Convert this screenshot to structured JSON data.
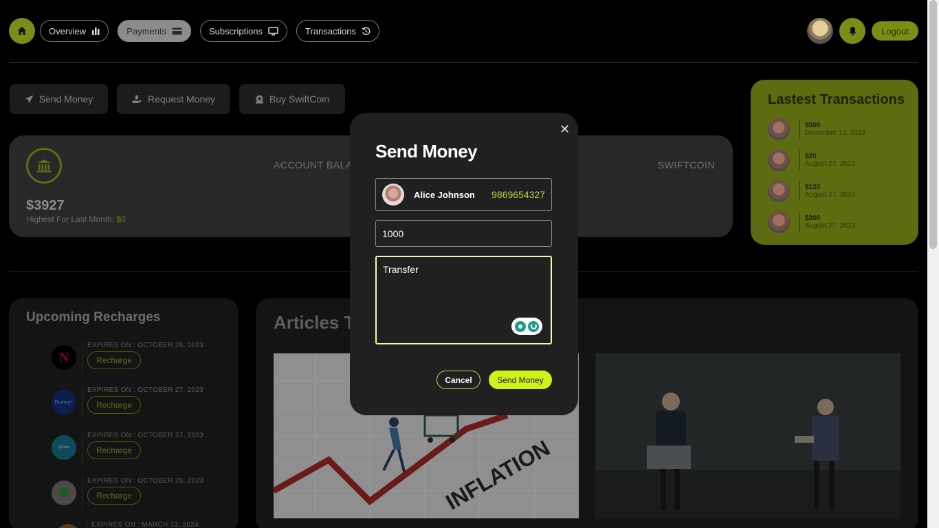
{
  "nav": {
    "home_icon": "home-icon",
    "items": [
      {
        "label": "Overview",
        "icon": "bar-chart-icon"
      },
      {
        "label": "Payments",
        "icon": "credit-card-icon",
        "active": true
      },
      {
        "label": "Subscriptions",
        "icon": "monitor-icon"
      },
      {
        "label": "Transactions",
        "icon": "history-icon"
      }
    ],
    "logout_label": "Logout"
  },
  "actions": {
    "send_label": "Send Money",
    "request_label": "Request Money",
    "buy_label": "Buy SwiftCoin"
  },
  "balance": {
    "amount": "$3927",
    "highest_label": "Highest For Last Month: ",
    "highest_value": "$0",
    "account_label": "ACCOUNT BALANCE",
    "coin_label": "SWIFTCOIN"
  },
  "latest_transactions": {
    "title": "Lastest Transactions",
    "items": [
      {
        "amount": "$500",
        "date": "December 13, 2023"
      },
      {
        "amount": "$20",
        "date": "August 27, 2023"
      },
      {
        "amount": "$120",
        "date": "August 27, 2023"
      },
      {
        "amount": "$200",
        "date": "August 27, 2023"
      }
    ]
  },
  "recharges": {
    "title": "Upcoming Recharges",
    "button_label": "Recharge",
    "items": [
      {
        "expires": "EXPIRES ON : OCTOBER 26, 2023",
        "service": "netflix",
        "logo_color": "#000000"
      },
      {
        "expires": "EXPIRES ON : OCTOBER 27, 2023",
        "service": "disney-hotstar",
        "logo_color": "#0c1e4f"
      },
      {
        "expires": "EXPIRES ON : OCTOBER 27, 2023",
        "service": "prime-video",
        "logo_color": "#1a98b8"
      },
      {
        "expires": "EXPIRES ON : OCTOBER 28, 2023",
        "service": "spotify",
        "logo_color": "#e8e8e8"
      },
      {
        "expires": "EXPIRES ON : MARCH 13, 2024",
        "service": "other",
        "logo_color": "#c87a3a"
      }
    ]
  },
  "articles": {
    "title": "Articles To Grow Your Portfolio",
    "image_text": "INFLATION"
  },
  "modal": {
    "title": "Send Money",
    "recipient_name": "Alice Johnson",
    "recipient_phone": "9869654327",
    "amount_value": "1000",
    "note_value": "Transfer",
    "cancel_label": "Cancel",
    "send_label": "Send Money",
    "close_icon": "close-icon"
  },
  "colors": {
    "accent": "#cdf21a",
    "accent_dim": "#7a8e17",
    "background": "#000000"
  }
}
